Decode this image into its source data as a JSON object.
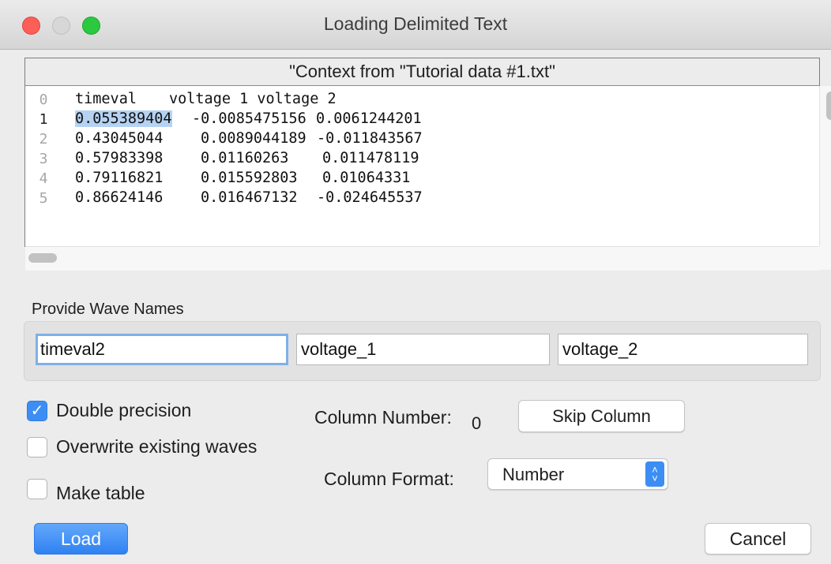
{
  "window": {
    "title": "Loading Delimited Text"
  },
  "preview": {
    "header": "\"Context from \"Tutorial data #1.txt\"",
    "line_numbers": [
      "0",
      "1",
      "2",
      "3",
      "4",
      "5"
    ],
    "lines": [
      [
        "timeval",
        "voltage 1 voltage 2",
        ""
      ],
      [
        "0.055389404",
        "-0.0085475156",
        "0.0061244201"
      ],
      [
        "0.43045044",
        "0.0089044189",
        "-0.011843567"
      ],
      [
        "0.57983398",
        "0.01160263",
        "0.011478119"
      ],
      [
        "0.79116821",
        "0.015592803",
        "0.01064331"
      ],
      [
        "0.86624146",
        "0.016467132",
        "-0.024645537"
      ]
    ]
  },
  "wave_names": {
    "label": "Provide Wave Names",
    "fields": [
      "timeval2",
      "voltage_1",
      "voltage_2"
    ]
  },
  "options": {
    "double_precision": {
      "label": "Double precision",
      "checked": true
    },
    "overwrite": {
      "label": "Overwrite existing waves",
      "checked": false
    },
    "make_table": {
      "label": "Make table",
      "checked": false
    }
  },
  "column": {
    "number_label": "Column Number:",
    "number_value": "0",
    "skip_label": "Skip Column",
    "format_label": "Column Format:",
    "format_value": "Number"
  },
  "buttons": {
    "load": "Load",
    "cancel": "Cancel"
  },
  "colors": {
    "accent": "#3c8ef4",
    "close": "#fc5f57",
    "maximize": "#2ac940",
    "selection": "#b6d2f2"
  }
}
